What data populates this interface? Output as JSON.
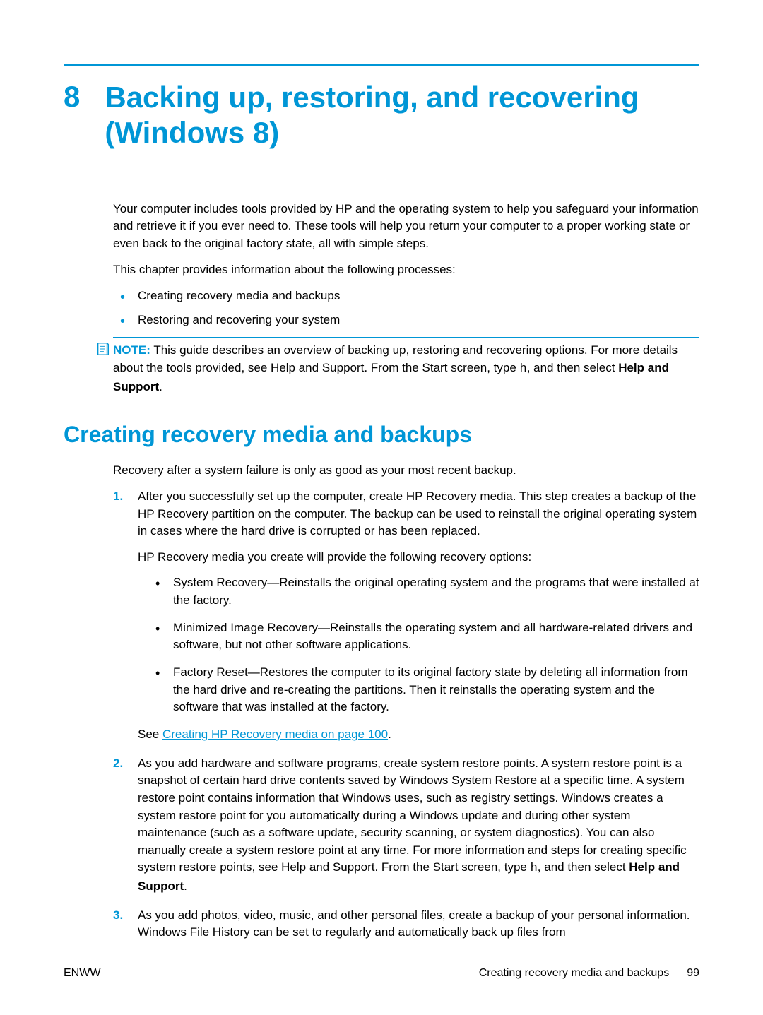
{
  "chapter": {
    "number": "8",
    "title": "Backing up, restoring, and recovering (Windows 8)"
  },
  "intro": {
    "p1": "Your computer includes tools provided by HP and the operating system to help you safeguard your information and retrieve it if you ever need to. These tools will help you return your computer to a proper working state or even back to the original factory state, all with simple steps.",
    "p2": "This chapter provides information about the following processes:",
    "bullets": [
      "Creating recovery media and backups",
      "Restoring and recovering your system"
    ]
  },
  "note": {
    "label": "NOTE:",
    "text1": "This guide describes an overview of backing up, restoring and recovering options. For more details about the tools provided, see Help and Support. From the Start screen, type ",
    "mono": "h",
    "text2": ", and then select ",
    "bold": "Help and Support",
    "text3": "."
  },
  "section": {
    "heading": "Creating recovery media and backups",
    "p1": "Recovery after a system failure is only as good as your most recent backup."
  },
  "steps": {
    "s1": {
      "num": "1.",
      "text": "After you successfully set up the computer, create HP Recovery media. This step creates a backup of the HP Recovery partition on the computer. The backup can be used to reinstall the original operating system in cases where the hard drive is corrupted or has been replaced.",
      "sub": "HP Recovery media you create will provide the following recovery options:",
      "bullets": [
        "System Recovery—Reinstalls the original operating system and the programs that were installed at the factory.",
        "Minimized Image Recovery—Reinstalls the operating system and all hardware-related drivers and software, but not other software applications.",
        "Factory Reset—Restores the computer to its original factory state by deleting all information from the hard drive and re-creating the partitions. Then it reinstalls the operating system and the software that was installed at the factory."
      ],
      "see": "See ",
      "link": "Creating HP Recovery media on page 100",
      "dot": "."
    },
    "s2": {
      "num": "2.",
      "t1": "As you add hardware and software programs, create system restore points. A system restore point is a snapshot of certain hard drive contents saved by Windows System Restore at a specific time. A system restore point contains information that Windows uses, such as registry settings. Windows creates a system restore point for you automatically during a Windows update and during other system maintenance (such as a software update, security scanning, or system diagnostics). You can also manually create a system restore point at any time. For more information and steps for creating specific system restore points, see Help and Support. From the Start screen, type ",
      "mono": "h",
      "t2": ", and then select ",
      "bold": "Help and Support",
      "t3": "."
    },
    "s3": {
      "num": "3.",
      "text": "As you add photos, video, music, and other personal files, create a backup of your personal information. Windows File History can be set to regularly and automatically back up files from"
    }
  },
  "footer": {
    "left": "ENWW",
    "center": "Creating recovery media and backups",
    "page": "99"
  }
}
